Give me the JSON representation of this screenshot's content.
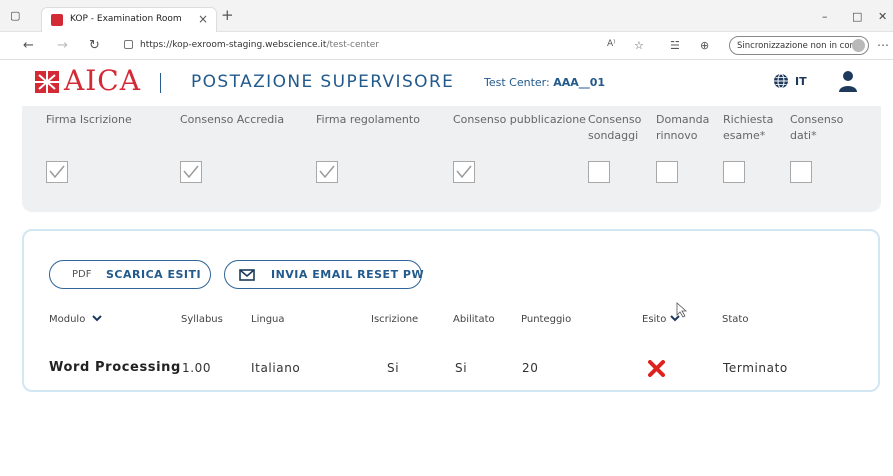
{
  "browser": {
    "tab_title": "KOP - Examination Room",
    "tab_close": "×",
    "new_tab": "+",
    "url_host": "https://kop-exroom-staging.webscience.it",
    "url_path": "/test-center",
    "sync_label": "Sincronizzazione non in corso",
    "reader_glyph": "A⁾",
    "favorite_glyph": "☆",
    "collections_glyph": "☱",
    "extensions_glyph": "⊕",
    "more_glyph": "⋯",
    "min_glyph": "–",
    "restore_glyph": "□",
    "close_glyph": "✕",
    "back_glyph": "←",
    "forward_glyph": "→",
    "reload_glyph": "↻"
  },
  "header": {
    "logo_text": "AICA",
    "title": "POSTAZIONE SUPERVISORE",
    "test_center_label": "Test Center:",
    "test_center_value": "AAA__01",
    "language": "IT"
  },
  "consents": [
    {
      "label": "Firma Iscrizione",
      "checked": true
    },
    {
      "label": "Consenso Accredia",
      "checked": true
    },
    {
      "label": "Firma regolamento",
      "checked": true
    },
    {
      "label": "Consenso pubblicazione",
      "checked": true
    },
    {
      "label": "Consenso\nsondaggi",
      "checked": false
    },
    {
      "label": "Domanda\nrinnovo",
      "checked": false
    },
    {
      "label": "Richiesta\nesame*",
      "checked": false
    },
    {
      "label": "Consenso\ndati*",
      "checked": false
    }
  ],
  "actions": {
    "pdf_icon_label": "PDF",
    "download_results": "SCARICA ESITI",
    "send_email_reset": "INVIA EMAIL RESET PW"
  },
  "table": {
    "headers": {
      "modulo": "Modulo",
      "syllabus": "Syllabus",
      "lingua": "Lingua",
      "iscrizione": "Iscrizione",
      "abilitato": "Abilitato",
      "punteggio": "Punteggio",
      "esito": "Esito",
      "stato": "Stato"
    },
    "rows": [
      {
        "modulo": "Word Processing",
        "syllabus": "1.00",
        "lingua": "Italiano",
        "iscrizione": "Si",
        "abilitato": "Si",
        "punteggio": "20",
        "esito": "fail",
        "stato": "Terminato"
      }
    ]
  },
  "colors": {
    "brand_red": "#d42a35",
    "brand_blue": "#235a8c",
    "panel_bg": "#eef0f2",
    "card_border": "#d2e6f4"
  }
}
